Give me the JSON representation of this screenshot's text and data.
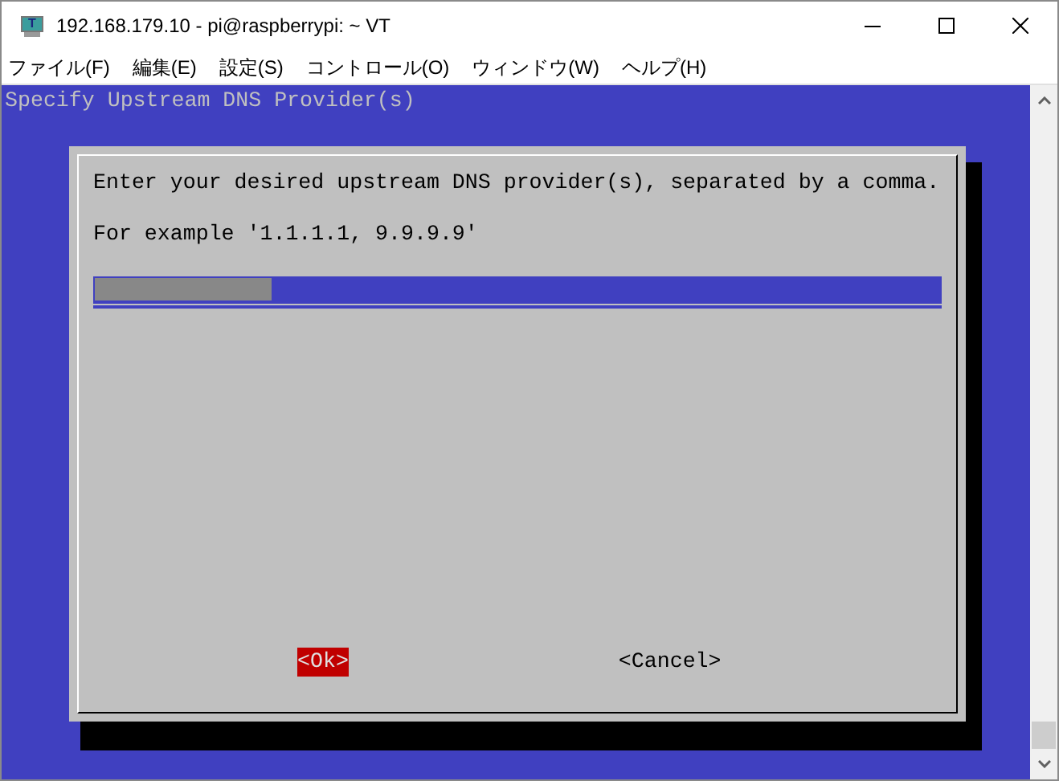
{
  "window": {
    "title": "192.168.179.10 - pi@raspberrypi: ~ VT",
    "icon_letter": "T"
  },
  "menu": [
    {
      "label": "ファイル(F)"
    },
    {
      "label": "編集(E)"
    },
    {
      "label": "設定(S)"
    },
    {
      "label": "コントロール(O)"
    },
    {
      "label": "ウィンドウ(W)"
    },
    {
      "label": "ヘルプ(H)"
    }
  ],
  "terminal": {
    "backtitle": "Specify Upstream DNS Provider(s)",
    "dialog": {
      "lines": [
        "Enter your desired upstream DNS provider(s), separated by a comma.",
        "For example '1.1.1.1, 9.9.9.9'"
      ],
      "buttons": [
        {
          "label": "<Ok>",
          "selected": true
        },
        {
          "label": "<Cancel>",
          "selected": false
        }
      ]
    }
  }
}
